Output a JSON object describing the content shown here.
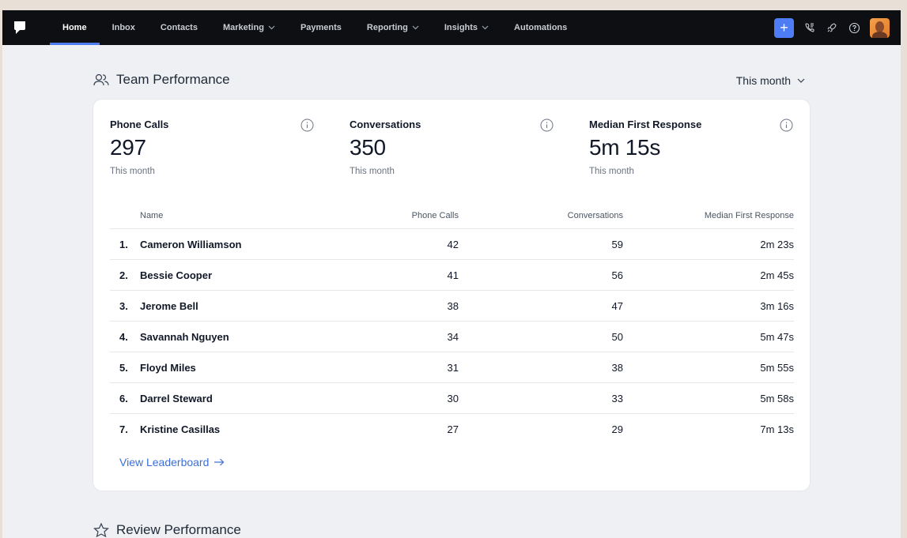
{
  "nav": {
    "items": [
      {
        "label": "Home",
        "active": true,
        "dropdown": false
      },
      {
        "label": "Inbox",
        "active": false,
        "dropdown": false
      },
      {
        "label": "Contacts",
        "active": false,
        "dropdown": false
      },
      {
        "label": "Marketing",
        "active": false,
        "dropdown": true
      },
      {
        "label": "Payments",
        "active": false,
        "dropdown": false
      },
      {
        "label": "Reporting",
        "active": false,
        "dropdown": true
      },
      {
        "label": "Insights",
        "active": false,
        "dropdown": true
      },
      {
        "label": "Automations",
        "active": false,
        "dropdown": false
      }
    ],
    "plus_label": "+",
    "icons": [
      "phone-icon",
      "rocket-icon",
      "help-icon",
      "avatar"
    ]
  },
  "team": {
    "title": "Team Performance",
    "period": "This month",
    "stats": [
      {
        "label": "Phone Calls",
        "value": "297",
        "sub": "This month"
      },
      {
        "label": "Conversations",
        "value": "350",
        "sub": "This month"
      },
      {
        "label": "Median First Response",
        "value": "5m 15s",
        "sub": "This month"
      }
    ],
    "columns": {
      "name": "Name",
      "calls": "Phone Calls",
      "conversations": "Conversations",
      "response": "Median First Response"
    },
    "rows": [
      {
        "rank": "1.",
        "name": "Cameron Williamson",
        "calls": "42",
        "conversations": "59",
        "response": "2m 23s"
      },
      {
        "rank": "2.",
        "name": "Bessie Cooper",
        "calls": "41",
        "conversations": "56",
        "response": "2m 45s"
      },
      {
        "rank": "3.",
        "name": "Jerome Bell",
        "calls": "38",
        "conversations": "47",
        "response": "3m 16s"
      },
      {
        "rank": "4.",
        "name": "Savannah Nguyen",
        "calls": "34",
        "conversations": "50",
        "response": "5m 47s"
      },
      {
        "rank": "5.",
        "name": "Floyd Miles",
        "calls": "31",
        "conversations": "38",
        "response": "5m 55s"
      },
      {
        "rank": "6.",
        "name": "Darrel Steward",
        "calls": "30",
        "conversations": "33",
        "response": "5m 58s"
      },
      {
        "rank": "7.",
        "name": "Kristine Casillas",
        "calls": "27",
        "conversations": "29",
        "response": "7m 13s"
      }
    ],
    "view_link": "View Leaderboard"
  },
  "review": {
    "title": "Review Performance"
  },
  "colors": {
    "accent": "#4d7cf4",
    "link": "#3b6fd8",
    "nav_bg": "#0d0f12",
    "page_bg": "#eef0f3"
  }
}
